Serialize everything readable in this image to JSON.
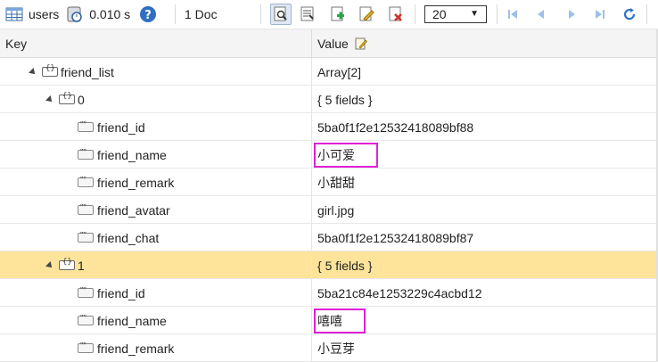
{
  "toolbar": {
    "collection": "users",
    "time": "0.010 s",
    "doc_count": "1 Doc",
    "page_size": "20"
  },
  "columns": {
    "key": "Key",
    "value": "Value"
  },
  "rows": [
    {
      "key": "friend_list",
      "value": "Array[2]",
      "type": "object"
    },
    {
      "key": "0",
      "value": "{ 5 fields }",
      "type": "object"
    },
    {
      "key": "friend_id",
      "value": "5ba0f1f2e12532418089bf88",
      "type": "string"
    },
    {
      "key": "friend_name",
      "value": "小可爱",
      "type": "string",
      "highlighted": true
    },
    {
      "key": "friend_remark",
      "value": "小甜甜",
      "type": "string"
    },
    {
      "key": "friend_avatar",
      "value": "girl.jpg",
      "type": "string"
    },
    {
      "key": "friend_chat",
      "value": "5ba0f1f2e12532418089bf87",
      "type": "string"
    },
    {
      "key": "1",
      "value": "{ 5 fields }",
      "type": "object",
      "selected": true
    },
    {
      "key": "friend_id",
      "value": "5ba21c84e1253229c4acbd12",
      "type": "string"
    },
    {
      "key": "friend_name",
      "value": "嘻嘻",
      "type": "string",
      "highlighted": true
    },
    {
      "key": "friend_remark",
      "value": "小豆芽",
      "type": "string"
    }
  ],
  "colors": {
    "selected_row": "#fde49a",
    "highlight_box": "#e020d8",
    "accent": "#3a8ee6"
  }
}
